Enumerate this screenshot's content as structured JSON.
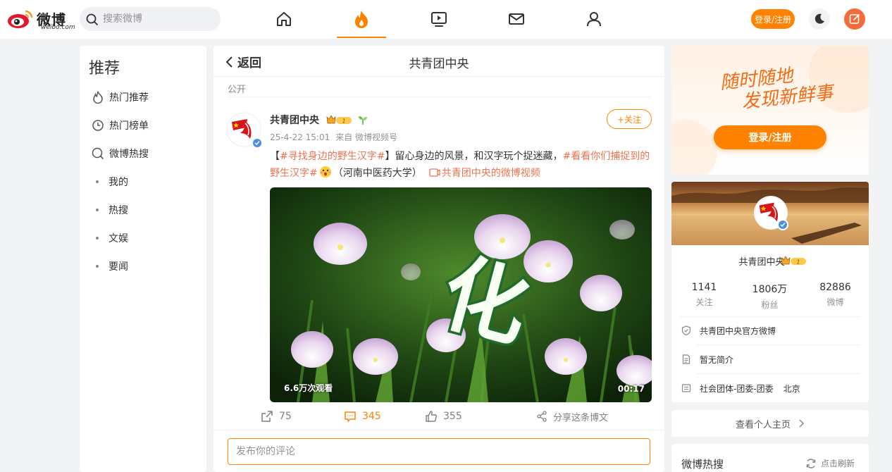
{
  "header": {
    "logo_text": "微博",
    "logo_sub": "weibo.com",
    "search_placeholder": "搜索微博",
    "nav": [
      "home-icon",
      "hot-flame-icon",
      "video-play-icon",
      "mail-icon",
      "user-icon"
    ],
    "login_label": "登录/注册",
    "accent": "#ff8200"
  },
  "sidebar": {
    "title": "推荐",
    "items": [
      {
        "label": "热门推荐",
        "icon": "flame-outline-icon"
      },
      {
        "label": "热门榜单",
        "icon": "clock-icon"
      },
      {
        "label": "微博热搜",
        "icon": "search-circle-icon"
      }
    ],
    "sub_items": [
      "我的",
      "热搜",
      "文娱",
      "要闻"
    ]
  },
  "detail": {
    "back_label": "返回",
    "title": "共青团中央",
    "visibility": "公开",
    "post": {
      "author": "共青团中央",
      "level": "1",
      "date": "25-4-22 15:01",
      "source": "来自 微博视频号",
      "follow_label": "+关注",
      "text_open": "【",
      "tag1": "#寻找身边的野生汉字#",
      "text_mid": "】留心身边的风景，和汉字玩个捉迷藏，",
      "tag2": "#看看你们捕捉到的野生汉字#",
      "text_tail": "（河南中医药大学）",
      "video_link": "共青团中央的微博视频",
      "video": {
        "views": "6.6万次观看",
        "duration": "00:17",
        "overlay_char": "化"
      },
      "actions": {
        "reposts": "75",
        "comments": "345",
        "likes": "355",
        "share_label": "分享这条博文"
      }
    },
    "comment_placeholder": "发布你的评论"
  },
  "promo": {
    "slogan_line1": "随时随地",
    "slogan_line2": "发现新鲜事",
    "button_label": "登录/注册"
  },
  "profile": {
    "name": "共青团中央",
    "level": "1",
    "stats": [
      {
        "value": "1141",
        "label": "关注"
      },
      {
        "value": "1806万",
        "label": "粉丝"
      },
      {
        "value": "82886",
        "label": "微博"
      }
    ],
    "verified": "共青团中央官方微博",
    "bio": "暂无简介",
    "category": "社会团体-团委-团委",
    "location": "北京"
  },
  "home_link": "查看个人主页",
  "hot_search": {
    "title": "微博热搜",
    "refresh_label": "点击刷新"
  }
}
